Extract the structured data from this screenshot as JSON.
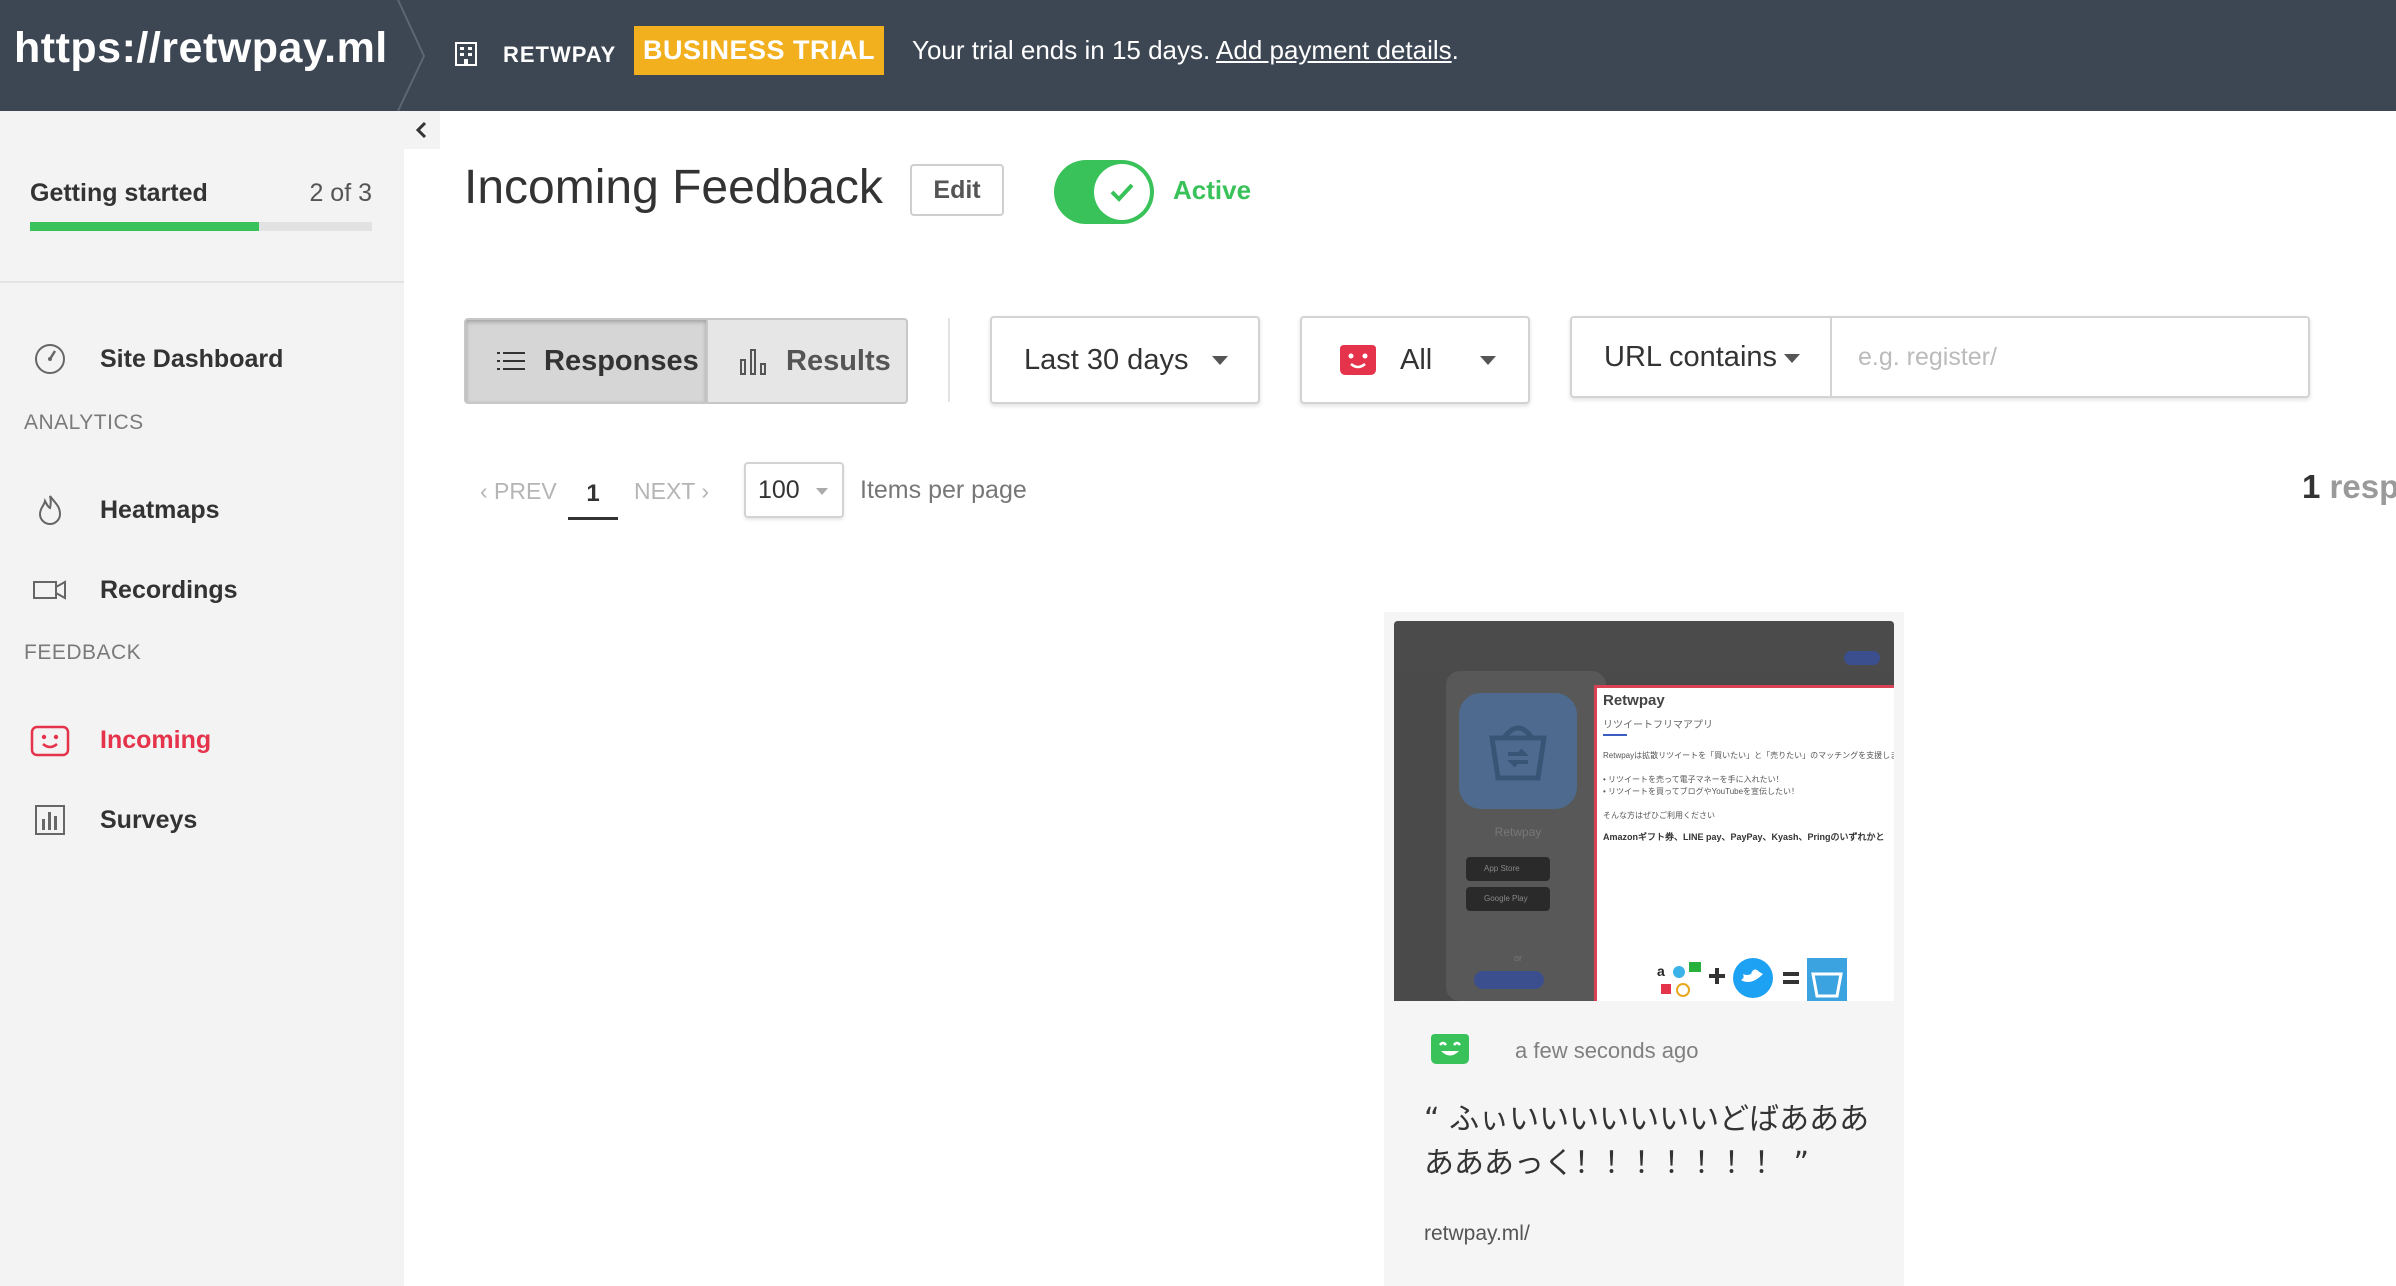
{
  "topbar": {
    "site_url": "https://retwpay.ml",
    "org_name": "RETWPAY",
    "trial_badge": "BUSINESS TRIAL",
    "trial_message": "Your trial ends in 15 days.",
    "trial_link": "Add payment details",
    "trial_suffix": "."
  },
  "sidebar": {
    "collapse_icon": "chevron-left-icon",
    "getting_started": {
      "title": "Getting started",
      "count": "2 of 3",
      "progress": 0.67
    },
    "items": [
      {
        "label": "Site Dashboard",
        "icon": "gauge-icon"
      },
      {
        "label": "Heatmaps",
        "icon": "flame-icon"
      },
      {
        "label": "Recordings",
        "icon": "video-camera-icon"
      },
      {
        "label": "Incoming",
        "icon": "feedback-face-icon",
        "active": true
      },
      {
        "label": "Surveys",
        "icon": "bar-chart-icon"
      }
    ],
    "sections": {
      "analytics": "ANALYTICS",
      "feedback": "FEEDBACK"
    }
  },
  "main": {
    "title": "Incoming Feedback",
    "edit_label": "Edit",
    "active_label": "Active",
    "active": true,
    "view_tabs": [
      {
        "label": "Responses",
        "icon": "list-icon",
        "selected": true
      },
      {
        "label": "Results",
        "icon": "bar-chart-icon",
        "selected": false
      }
    ],
    "date_filter": "Last 30 days",
    "mood_filter": "All",
    "url_filter": {
      "mode": "URL contains",
      "placeholder": "e.g. register/",
      "value": ""
    },
    "pagination": {
      "prev": "‹ PREV",
      "current": "1",
      "next": "NEXT ›",
      "per_page": "100",
      "per_page_label": "Items per page"
    },
    "response_count": {
      "number": "1",
      "label": "resp"
    }
  },
  "response": {
    "time": "a few seconds ago",
    "mood_icon": "happy-face-icon",
    "quote": "“ ふぃいいいいいいいどばああああああっく！！！！！！！ ”",
    "url": "retwpay.ml/",
    "screenshot": {
      "app_title": "Retwpay",
      "app_subtitle": "リツイートフリマアプリ",
      "app_name": "Retwpay",
      "store_labels": [
        "App Store",
        "Google Play"
      ],
      "or_text": "or",
      "lines": [
        "Retwpayは拡散リツイートを「買いたい」と「売りたい」のマッチングを支援します。",
        "• リツイートを売って電子マネーを手に入れたい！",
        "• リツイートを買ってブログやYouTubeを宣伝したい！",
        "そんな方はぜひご利用ください"
      ],
      "bold_line": "Amazonギフト券、LINE pay、PayPay、Kyash、Pringのいずれかと"
    }
  },
  "colors": {
    "topbar": "#3d4653",
    "badge": "#f2b01e",
    "accent_green": "#3ac25a",
    "accent_red": "#e5334b"
  }
}
